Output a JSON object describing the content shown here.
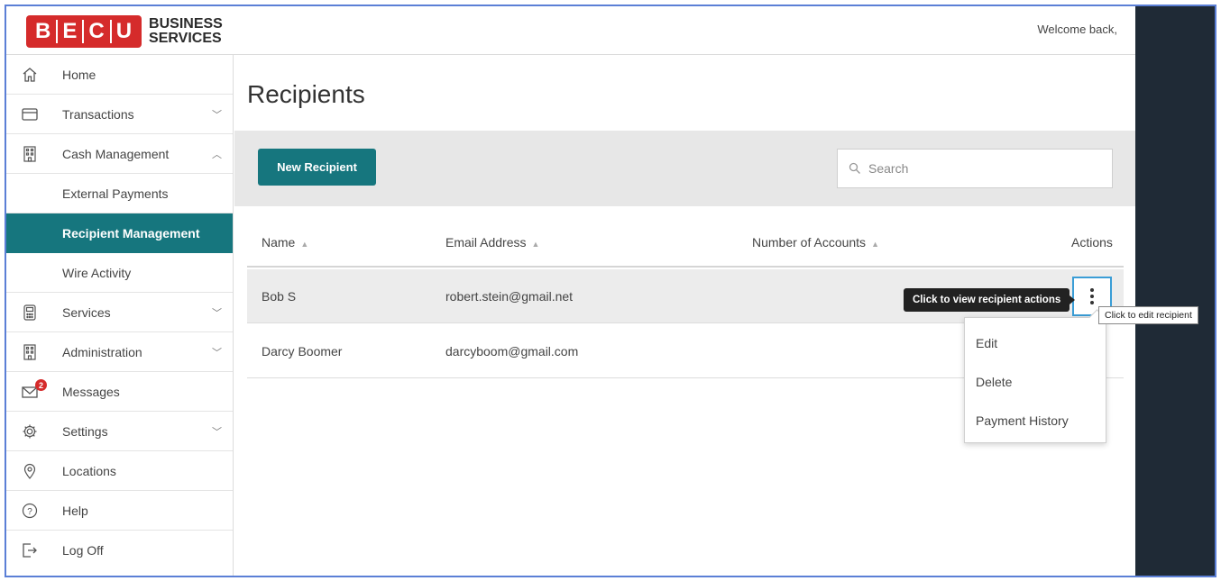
{
  "header": {
    "logo_letters": [
      "B",
      "E",
      "C",
      "U"
    ],
    "logo_line1": "BUSINESS",
    "logo_line2": "SERVICES",
    "welcome": "Welcome back,"
  },
  "sidebar": {
    "items": [
      {
        "label": "Home",
        "icon": "home-icon"
      },
      {
        "label": "Transactions",
        "icon": "card-icon",
        "chevron": "down"
      },
      {
        "label": "Cash Management",
        "icon": "building-icon",
        "chevron": "up"
      },
      {
        "label": "External Payments"
      },
      {
        "label": "Recipient Management",
        "active": true
      },
      {
        "label": "Wire Activity"
      },
      {
        "label": "Services",
        "icon": "calculator-icon",
        "chevron": "down"
      },
      {
        "label": "Administration",
        "icon": "building-icon",
        "chevron": "down"
      },
      {
        "label": "Messages",
        "icon": "envelope-icon",
        "badge": "2"
      },
      {
        "label": "Settings",
        "icon": "gear-icon",
        "chevron": "down"
      },
      {
        "label": "Locations",
        "icon": "location-pin-icon"
      },
      {
        "label": "Help",
        "icon": "help-circle-icon"
      },
      {
        "label": "Log Off",
        "icon": "logout-icon"
      }
    ]
  },
  "main": {
    "title": "Recipients",
    "new_button": "New Recipient",
    "search_placeholder": "Search",
    "columns": [
      "Name",
      "Email Address",
      "Number of Accounts",
      "Actions"
    ],
    "rows": [
      {
        "name": "Bob S",
        "email": "robert.stein@gmail.net",
        "accounts": ""
      },
      {
        "name": "Darcy Boomer",
        "email": "darcyboom@gmail.com",
        "accounts": ""
      }
    ],
    "actions_tooltip": "Click to view recipient actions",
    "edit_tooltip": "Click to edit recipient",
    "menu": [
      "Edit",
      "Delete",
      "Payment History"
    ]
  },
  "colors": {
    "brand_red": "#d52b2b",
    "teal": "#16767e",
    "dark_panel": "#1f2a36"
  }
}
